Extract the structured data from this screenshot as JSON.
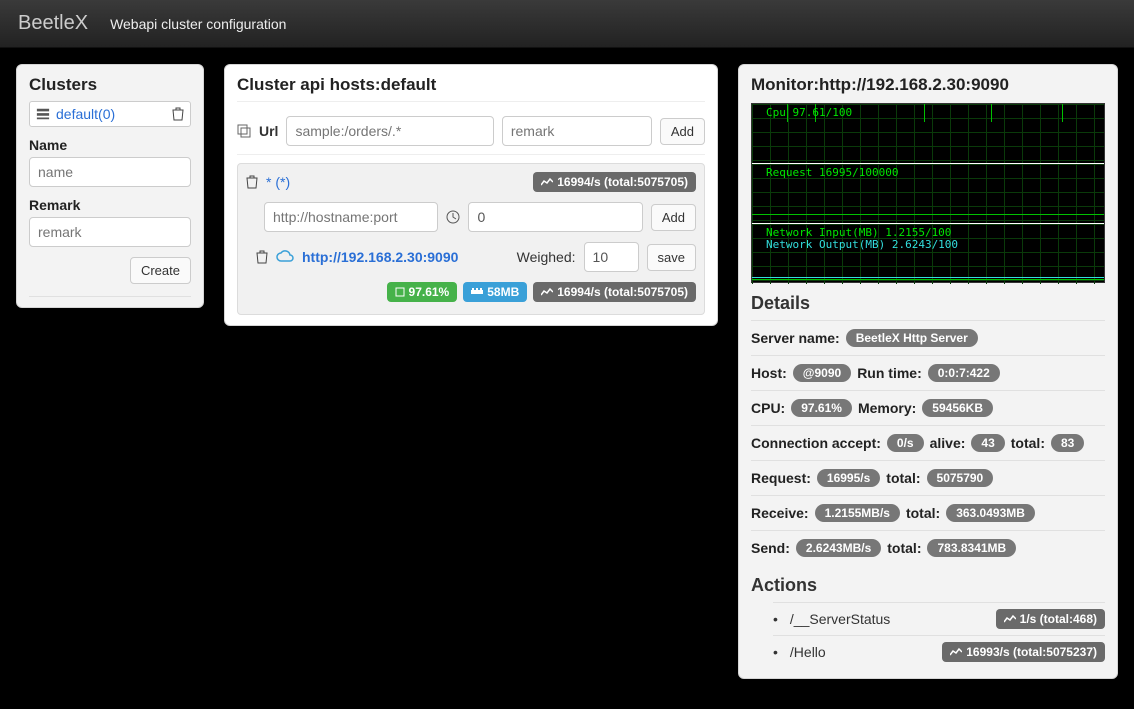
{
  "header": {
    "brand": "BeetleX",
    "subtitle": "Webapi cluster configuration"
  },
  "clusters": {
    "title": "Clusters",
    "items": [
      {
        "label": "default(0)"
      }
    ],
    "form": {
      "name_label": "Name",
      "name_placeholder": "name",
      "remark_label": "Remark",
      "remark_placeholder": "remark",
      "create_label": "Create"
    }
  },
  "hosts": {
    "title": "Cluster api hosts:default",
    "url_row": {
      "label": "Url",
      "url_placeholder": "sample:/orders/.*",
      "remark_placeholder": "remark",
      "add_label": "Add"
    },
    "entry": {
      "pattern": "* (*)",
      "summary": "16994/s (total:5075705)",
      "host_placeholder": "http://hostname:port",
      "interval_value": "0",
      "add_label": "Add",
      "host_url": "http://192.168.2.30:9090",
      "weighed_label": "Weighed:",
      "weighed_value": "10",
      "save_label": "save",
      "stats": {
        "cpu": "97.61%",
        "mem": "58MB",
        "rps": "16994/s (total:5075705)"
      }
    }
  },
  "monitor": {
    "title": "Monitor:http://192.168.2.30:9090",
    "chart_labels": {
      "cpu": "Cpu 97.61/100",
      "req": "Request 16995/100000",
      "net_in": "Network Input(MB) 1.2155/100",
      "net_out": "Network Output(MB) 2.6243/100"
    },
    "details_title": "Details",
    "details": {
      "server_name_label": "Server name:",
      "server_name": "BeetleX Http Server",
      "host_label": "Host:",
      "host": "@9090",
      "runtime_label": "Run time:",
      "runtime": "0:0:7:422",
      "cpu_label": "CPU:",
      "cpu": "97.61%",
      "memory_label": "Memory:",
      "memory": "59456KB",
      "conn_label": "Connection accept:",
      "conn_rate": "0/s",
      "alive_label": "alive:",
      "alive": "43",
      "total_label": "total:",
      "conn_total": "83",
      "request_label": "Request:",
      "request_rate": "16995/s",
      "request_total": "5075790",
      "receive_label": "Receive:",
      "receive_rate": "1.2155MB/s",
      "receive_total": "363.0493MB",
      "send_label": "Send:",
      "send_rate": "2.6243MB/s",
      "send_total": "783.8341MB"
    },
    "actions_title": "Actions",
    "actions": [
      {
        "name": "/__ServerStatus",
        "stat": "1/s (total:468)"
      },
      {
        "name": "/Hello",
        "stat": "16993/s (total:5075237)"
      }
    ]
  },
  "chart_data": [
    {
      "type": "line",
      "title": "Cpu",
      "ylim": [
        0,
        100
      ],
      "value": 97.61
    },
    {
      "type": "line",
      "title": "Request",
      "ylim": [
        0,
        100000
      ],
      "value": 16995
    },
    {
      "type": "line",
      "title": "Network Input(MB)",
      "ylim": [
        0,
        100
      ],
      "value": 1.2155
    },
    {
      "type": "line",
      "title": "Network Output(MB)",
      "ylim": [
        0,
        100
      ],
      "value": 2.6243
    }
  ]
}
